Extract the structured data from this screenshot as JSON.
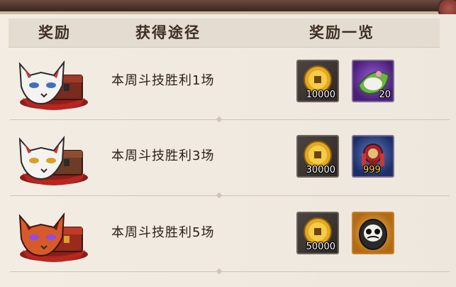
{
  "header": {
    "reward": "奖励",
    "method": "获得途径",
    "reward_list": "奖励一览"
  },
  "rows": [
    {
      "chest_icon": "white-fox-mask-chest-icon",
      "method": "本周斗技胜利1场",
      "items": [
        {
          "icon": "gold-coin-icon",
          "count": "10000"
        },
        {
          "icon": "rice-cake-leaf-icon",
          "count": "20"
        }
      ]
    },
    {
      "chest_icon": "white-fox-mask-chest-icon",
      "method": "本周斗技胜利3场",
      "items": [
        {
          "icon": "gold-coin-icon",
          "count": "30000"
        },
        {
          "icon": "drum-doll-icon",
          "count": "999"
        }
      ]
    },
    {
      "chest_icon": "red-fox-mask-chest-icon",
      "method": "本周斗技胜利5场",
      "items": [
        {
          "icon": "gold-coin-icon",
          "count": "50000"
        },
        {
          "icon": "daruma-icon",
          "count": ""
        }
      ]
    }
  ],
  "colors": {
    "background": "#efe8de",
    "header_bg": "#e4dcd1",
    "text": "#2c2018",
    "purple_item": "#9b5bd6",
    "blue_item": "#5c7ec7",
    "gold_item": "#f2c45a"
  }
}
